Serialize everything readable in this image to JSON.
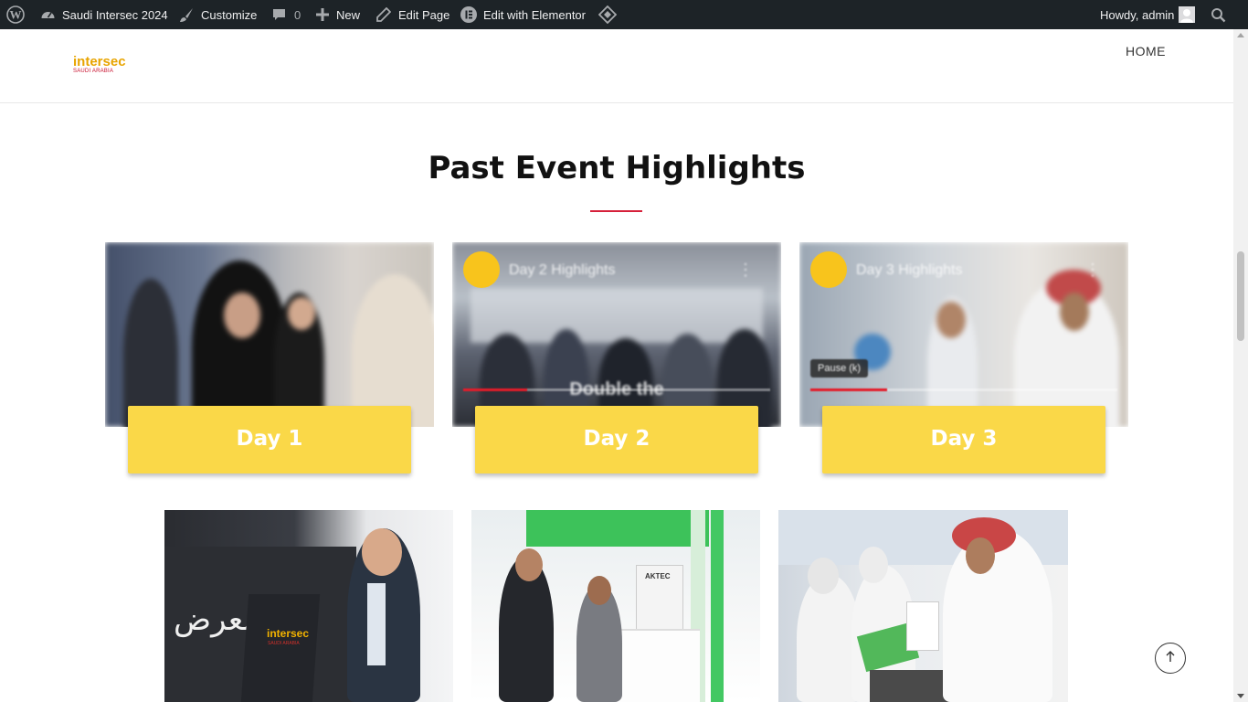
{
  "admin_bar": {
    "site_name": "Saudi Intersec 2024",
    "customize": "Customize",
    "comments_count": "0",
    "new": "New",
    "edit_page": "Edit Page",
    "edit_elementor": "Edit with Elementor",
    "greeting": "Howdy, admin"
  },
  "header": {
    "logo_main": "intersec",
    "logo_sub": "SAUDI ARABIA",
    "nav": [
      "HOME"
    ]
  },
  "section": {
    "title": "Past Event Highlights",
    "accent_color": "#d6203a"
  },
  "videos": [
    {
      "label": "Day 1",
      "yt_title": "",
      "overlay": ""
    },
    {
      "label": "Day 2",
      "yt_title": "Day 2 Highlights",
      "overlay": "Double the"
    },
    {
      "label": "Day 3",
      "yt_title": "Day 3 Highlights",
      "tooltip": "Pause (k)"
    }
  ],
  "photo_logo": {
    "main": "intersec",
    "sub": "SAUDI ARABIA"
  },
  "colors": {
    "admin_bar": "#1d2327",
    "day_label": "#fad848",
    "logo_main": "#e8a400",
    "logo_sub": "#c8102e"
  },
  "icons": [
    "wordpress-icon",
    "dashboard-icon",
    "brush-icon",
    "comment-icon",
    "plus-icon",
    "pencil-icon",
    "elementor-icon",
    "diamond-icon",
    "avatar",
    "search-icon",
    "arrow-up-icon"
  ]
}
